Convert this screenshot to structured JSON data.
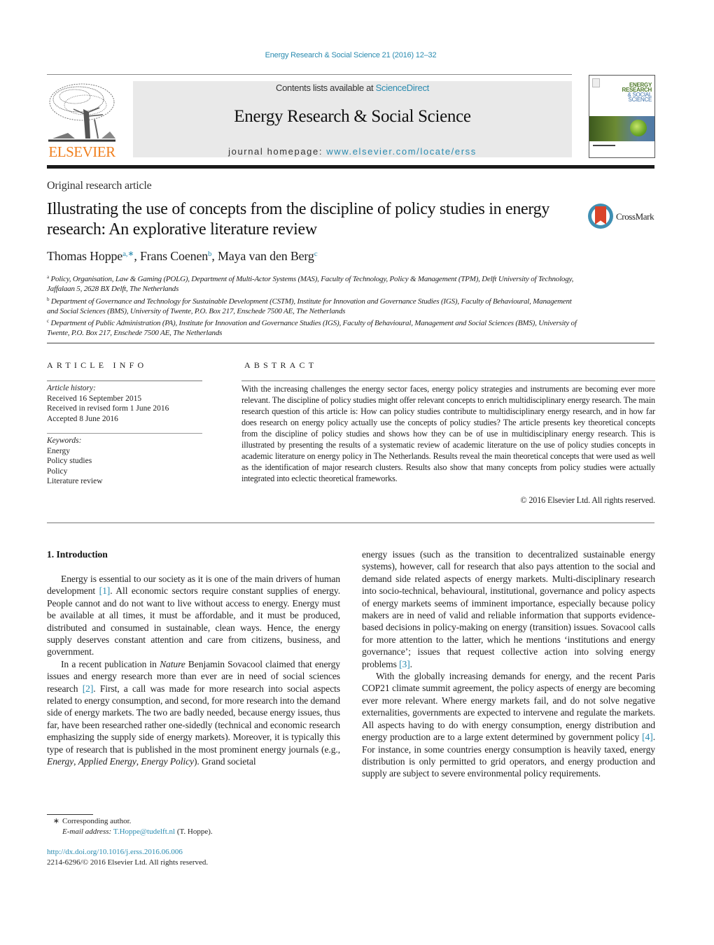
{
  "running_head": "Energy Research & Social Science 21 (2016) 12–32",
  "masthead": {
    "publisher": "ELSEVIER",
    "contents_prefix": "Contents lists available at ",
    "contents_link": "ScienceDirect",
    "journal_title": "Energy Research & Social Science",
    "homepage_prefix": "journal homepage: ",
    "homepage_link": "www.elsevier.com/locate/erss",
    "cover": {
      "line1": "ENERGY",
      "line2": "RESEARCH",
      "line3": "& SOCIAL",
      "line4": "SCIENCE"
    },
    "colors": {
      "link": "#2a8bb0",
      "publisher_orange": "#f07f1d",
      "masthead_bg": "#e9e9e9"
    }
  },
  "article": {
    "type": "Original research article",
    "title": "Illustrating the use of concepts from the discipline of policy studies in energy research: An explorative literature review",
    "crossmark_label": "CrossMark",
    "authors": [
      {
        "name": "Thomas Hoppe",
        "sup": "a,∗",
        "sep": ", "
      },
      {
        "name": "Frans Coenen",
        "sup": "b",
        "sep": ", "
      },
      {
        "name": "Maya van den Berg",
        "sup": "c",
        "sep": ""
      }
    ],
    "affiliations": [
      {
        "mark": "a",
        "text": "Policy, Organisation, Law & Gaming (POLG), Department of Multi-Actor Systems (MAS), Faculty of Technology, Policy & Management (TPM), Delft University of Technology, Jaffalaan 5, 2628 BX Delft, The Netherlands"
      },
      {
        "mark": "b",
        "text": "Department of Governance and Technology for Sustainable Development (CSTM), Institute for Innovation and Governance Studies (IGS), Faculty of Behavioural, Management and Social Sciences (BMS), University of Twente, P.O. Box 217, Enschede 7500 AE, The Netherlands"
      },
      {
        "mark": "c",
        "text": "Department of Public Administration (PA), Institute for Innovation and Governance Studies (IGS), Faculty of Behavioural, Management and Social Sciences (BMS), University of Twente, P.O. Box 217, Enschede 7500 AE, The Netherlands"
      }
    ]
  },
  "article_info": {
    "heading": "ARTICLE INFO",
    "history_label": "Article history:",
    "history": [
      "Received 16 September 2015",
      "Received in revised form 1 June 2016",
      "Accepted 8 June 2016"
    ],
    "keywords_label": "Keywords:",
    "keywords": [
      "Energy",
      "Policy studies",
      "Policy",
      "Literature review"
    ]
  },
  "abstract": {
    "heading": "ABSTRACT",
    "text": "With the increasing challenges the energy sector faces, energy policy strategies and instruments are becoming ever more relevant. The discipline of policy studies might offer relevant concepts to enrich multidisciplinary energy research. The main research question of this article is: How can policy studies contribute to multidisciplinary energy research, and in how far does research on energy policy actually use the concepts of policy studies? The article presents key theoretical concepts from the discipline of policy studies and shows how they can be of use in multidisciplinary energy research. This is illustrated by presenting the results of a systematic review of academic literature on the use of policy studies concepts in academic literature on energy policy in The Netherlands. Results reveal the main theoretical concepts that were used as well as the identification of major research clusters. Results also show that many concepts from policy studies were actually integrated into eclectic theoretical frameworks.",
    "copyright": "© 2016 Elsevier Ltd. All rights reserved."
  },
  "body": {
    "section_heading": "1.  Introduction",
    "p1": {
      "a": "Energy is essential to our society as it is one of the main drivers of human development ",
      "ref": "[1]",
      "b": ". All economic sectors require constant supplies of energy. People cannot and do not want to live without access to energy. Energy must be available at all times, it must be affordable, and it must be produced, distributed and consumed in sustainable, clean ways. Hence, the energy supply deserves constant attention and care from citizens, business, and government."
    },
    "p2": {
      "a": "In a recent publication in ",
      "italic1": "Nature",
      "b": " Benjamin Sovacool claimed that energy issues and energy research more than ever are in need of social sciences research ",
      "ref": "[2]",
      "c": ". First, a call was made for more research into social aspects related to energy consumption, and second, for more research into the demand side of energy markets. The two are badly needed, because energy issues, thus far, have been researched rather one-sidedly (technical and economic research emphasizing the supply side of energy markets). Moreover, it is typically this type of research that is published in the most prominent energy journals (e.g., ",
      "j1": "Energy",
      "j2": "Applied Energy",
      "j3": "Energy Policy",
      "d": "). Grand societal"
    },
    "p2_cont": {
      "a": "energy issues (such as the transition to decentralized sustainable energy systems), however, call for research that also pays attention to the social and demand side related aspects of energy markets. Multi-disciplinary research into socio-technical, behavioural, institutional, governance and policy aspects of energy markets seems of imminent importance, especially because policy makers are in need of valid and reliable information that supports evidence-based decisions in policy-making on energy (transition) issues. Sovacool calls for more attention to the latter, which he mentions ‘institutions and energy governance’; issues that request collective action into solving energy problems ",
      "ref": "[3]",
      "b": "."
    },
    "p3": {
      "a": "With the globally increasing demands for energy, and the recent Paris COP21 climate summit agreement, the policy aspects of energy are becoming ever more relevant. Where energy markets fail, and do not solve negative externalities, governments are expected to intervene and regulate the markets. All aspects having to do with energy consumption, energy distribution and energy production are to a large extent determined by government policy ",
      "ref": "[4]",
      "b": ". For instance, in some countries energy consumption is heavily taxed, energy distribution is only permitted to grid operators, and energy production and supply are subject to severe environmental policy requirements."
    }
  },
  "footnote": {
    "star": "∗",
    "corresponding": "Corresponding author.",
    "email_label": "E-mail address: ",
    "email": "T.Hoppe@tudelft.nl",
    "email_suffix": " (T. Hoppe).",
    "doi": "http://dx.doi.org/10.1016/j.erss.2016.06.006",
    "issn_line": "2214-6296/© 2016 Elsevier Ltd. All rights reserved."
  }
}
